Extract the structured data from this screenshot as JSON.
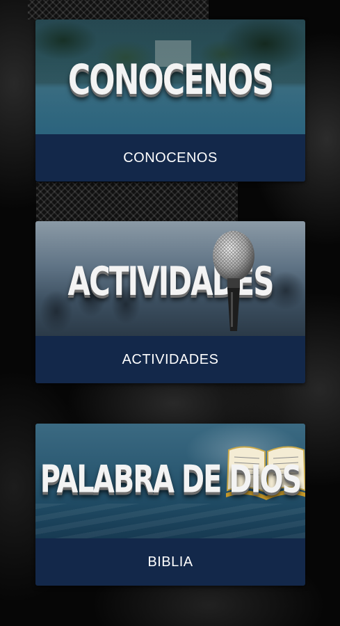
{
  "cards": [
    {
      "banner_text": "CONOCENOS",
      "label": "CONOCENOS"
    },
    {
      "banner_text": "ACTIVIDADES",
      "label": "ACTIVIDADES"
    },
    {
      "banner_text": "PALABRA DE DIOS",
      "label": "BIBLIA"
    }
  ],
  "colors": {
    "label_bar": "#13284a",
    "background": "#060606"
  },
  "icons": [
    "microphone-icon",
    "bible-book-icon"
  ]
}
